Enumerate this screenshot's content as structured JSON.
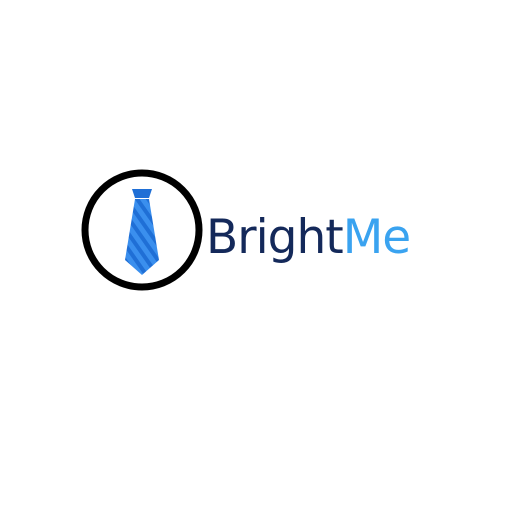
{
  "logo": {
    "icon": "necktie-icon",
    "wordmark_primary": "Bright",
    "wordmark_secondary": "Me",
    "colors": {
      "ring": "#000000",
      "tie_light": "#3a8fee",
      "tie_dark": "#1f6fd6",
      "wordmark_primary": "#14295a",
      "wordmark_secondary": "#3aa3f0",
      "background": "#ffffff"
    }
  }
}
